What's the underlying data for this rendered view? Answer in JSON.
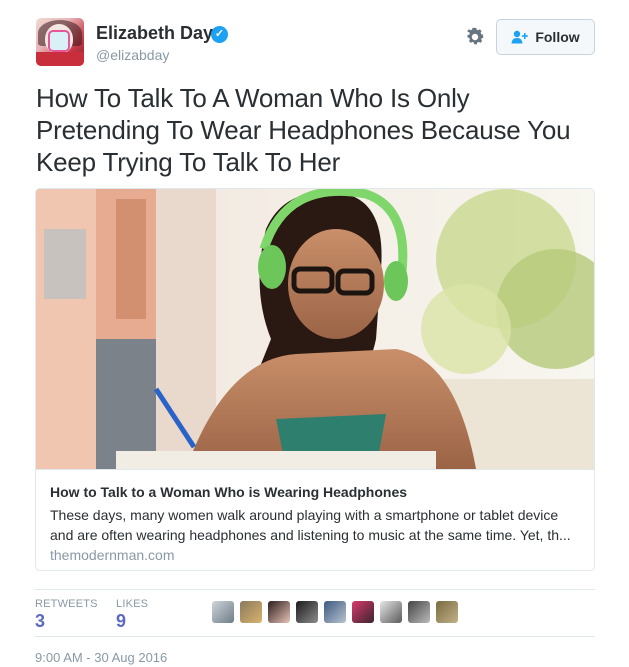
{
  "user": {
    "display_name": "Elizabeth Day",
    "handle": "@elizabday",
    "verified_icon": "verified-badge-icon"
  },
  "actions": {
    "follow_label": "Follow",
    "settings_icon": "gear-icon"
  },
  "tweet": {
    "text": "How To Talk To A Woman Who Is Only Pretending To Wear Headphones Because You Keep Trying To Talk To Her"
  },
  "card": {
    "title": "How to Talk to a Woman Who is Wearing Headphones",
    "description": "These days, many women walk around playing with a smartphone or tablet device and are often wearing headphones and listening to music at the same time. Yet, th...",
    "domain": "themodernman.com"
  },
  "stats": {
    "retweets_label": "RETWEETS",
    "retweets_count": "3",
    "likes_label": "LIKES",
    "likes_count": "9",
    "likers": [
      "liker-avatar-1",
      "liker-avatar-2",
      "liker-avatar-3",
      "liker-avatar-4",
      "liker-avatar-5",
      "liker-avatar-6",
      "liker-avatar-7",
      "liker-avatar-8",
      "liker-avatar-9"
    ]
  },
  "timestamp": "9:00 AM - 30 Aug 2016",
  "colors": {
    "link_blue": "#1da1f2",
    "stat_count": "#5c6bc0",
    "muted_text": "#8899a6",
    "border": "#e1e8ed"
  }
}
